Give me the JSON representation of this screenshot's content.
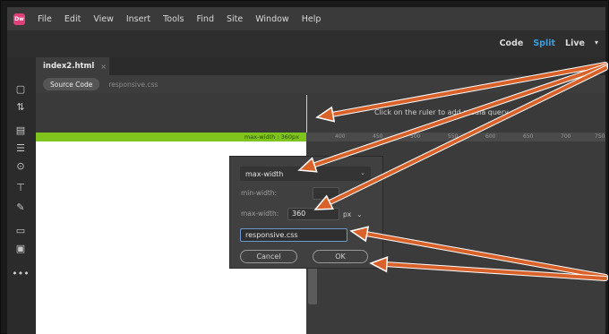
{
  "menubar": {
    "app_icon": "Dw",
    "items": [
      "File",
      "Edit",
      "View",
      "Insert",
      "Tools",
      "Find",
      "Site",
      "Window",
      "Help"
    ]
  },
  "toolbar": {
    "code": "Code",
    "split": "Split",
    "live": "Live",
    "live_caret": "▾"
  },
  "document": {
    "tab_name": "index2.html",
    "tab_close": "×",
    "source_code": "Source Code",
    "related_file": "responsive.css"
  },
  "ruler": {
    "hint": "Click on the ruler to add media query",
    "media_label": "max-width : 360px",
    "ticks": [
      "400",
      "450",
      "500",
      "550",
      "600",
      "650",
      "700",
      "750"
    ]
  },
  "dialog": {
    "condition": "max-width",
    "min_width_label": "min-width:",
    "max_width_label": "max-width:",
    "max_width_value": "360",
    "unit": "px",
    "css_file": "responsive.css",
    "cancel": "Cancel",
    "ok": "OK"
  },
  "colors": {
    "accent": "#3a9fe0",
    "media_bar": "#7fc41d",
    "annotation_arrow": "#d9622b"
  }
}
